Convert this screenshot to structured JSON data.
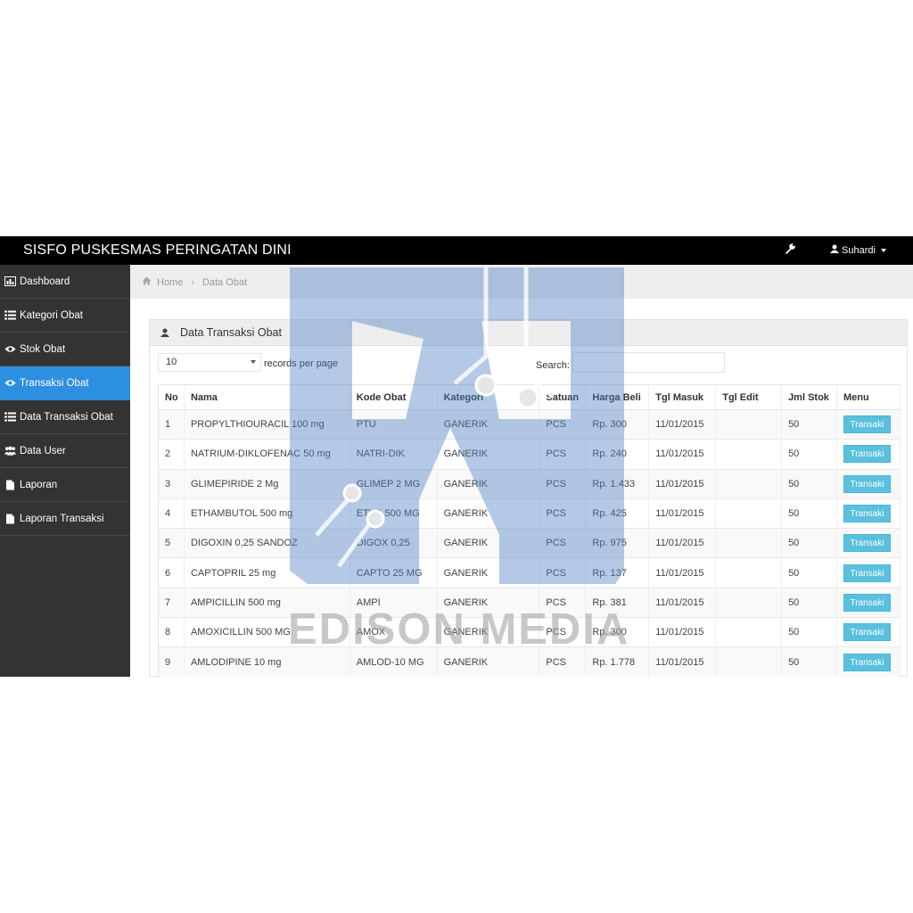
{
  "app": {
    "title": "SISFO PUSKESMAS PERINGATAN DINI"
  },
  "navbar": {
    "user": "Suhardi"
  },
  "sidebar": {
    "items": [
      {
        "label": "Dashboard",
        "icon": "bar-chart-icon"
      },
      {
        "label": "Kategori Obat",
        "icon": "list-icon"
      },
      {
        "label": "Stok Obat",
        "icon": "eye-icon"
      },
      {
        "label": "Transaksi Obat",
        "icon": "eye-icon",
        "active": true
      },
      {
        "label": "Data Transaksi Obat",
        "icon": "list-icon"
      },
      {
        "label": "Data User",
        "icon": "users-icon"
      },
      {
        "label": "Laporan",
        "icon": "file-icon"
      },
      {
        "label": "Laporan Transaksi",
        "icon": "file-icon"
      }
    ]
  },
  "breadcrumb": {
    "home": "Home",
    "current": "Data Obat"
  },
  "panel": {
    "title": "Data Transaksi Obat"
  },
  "table_controls": {
    "records_value": "10",
    "records_label": "records per page",
    "search_label": "Search:"
  },
  "table": {
    "headers": [
      "No",
      "Nama",
      "Kode Obat",
      "Kategori",
      "Satuan",
      "Harga Beli",
      "Tgl Masuk",
      "Tgl Edit",
      "Jml Stok",
      "Menu"
    ],
    "rows": [
      {
        "no": "1",
        "nama": "PROPYLTHIOURACIL 100 mg",
        "kode": "PTU",
        "kategori": "GANERIK",
        "satuan": "PCS",
        "harga": "Rp. 300",
        "tgl_masuk": "11/01/2015",
        "tgl_edit": "",
        "stok": "50",
        "menu": "Transaki"
      },
      {
        "no": "2",
        "nama": "NATRIUM-DIKLOFENAC 50 mg",
        "kode": "NATRI-DIK",
        "kategori": "GANERIK",
        "satuan": "PCS",
        "harga": "Rp. 240",
        "tgl_masuk": "11/01/2015",
        "tgl_edit": "",
        "stok": "50",
        "menu": "Transaki"
      },
      {
        "no": "3",
        "nama": "GLIMEPIRIDE 2 Mg",
        "kode": "GLIMEP 2 MG",
        "kategori": "GANERIK",
        "satuan": "PCS",
        "harga": "Rp. 1.433",
        "tgl_masuk": "11/01/2015",
        "tgl_edit": "",
        "stok": "50",
        "menu": "Transaki"
      },
      {
        "no": "4",
        "nama": "ETHAMBUTOL 500 mg",
        "kode": "ETHA 500 MG",
        "kategori": "GANERIK",
        "satuan": "PCS",
        "harga": "Rp. 425",
        "tgl_masuk": "11/01/2015",
        "tgl_edit": "",
        "stok": "50",
        "menu": "Transaki"
      },
      {
        "no": "5",
        "nama": "DIGOXIN 0,25 SANDOZ",
        "kode": "DIGOX 0,25",
        "kategori": "GANERIK",
        "satuan": "PCS",
        "harga": "Rp. 975",
        "tgl_masuk": "11/01/2015",
        "tgl_edit": "",
        "stok": "50",
        "menu": "Transaki"
      },
      {
        "no": "6",
        "nama": "CAPTOPRIL 25 mg",
        "kode": "CAPTO 25 MG",
        "kategori": "GANERIK",
        "satuan": "PCS",
        "harga": "Rp. 137",
        "tgl_masuk": "11/01/2015",
        "tgl_edit": "",
        "stok": "50",
        "menu": "Transaki"
      },
      {
        "no": "7",
        "nama": "AMPICILLIN 500 mg",
        "kode": "AMPI",
        "kategori": "GANERIK",
        "satuan": "PCS",
        "harga": "Rp. 381",
        "tgl_masuk": "11/01/2015",
        "tgl_edit": "",
        "stok": "50",
        "menu": "Transaki"
      },
      {
        "no": "8",
        "nama": "AMOXICILLIN 500 MG",
        "kode": "AMOX",
        "kategori": "GANERIK",
        "satuan": "PCS",
        "harga": "Rp. 300",
        "tgl_masuk": "11/01/2015",
        "tgl_edit": "",
        "stok": "50",
        "menu": "Transaki"
      },
      {
        "no": "9",
        "nama": "AMLODIPINE 10 mg",
        "kode": "AMLOD-10 MG",
        "kategori": "GANERIK",
        "satuan": "PCS",
        "harga": "Rp. 1.778",
        "tgl_masuk": "11/01/2015",
        "tgl_edit": "",
        "stok": "50",
        "menu": "Transaki"
      }
    ]
  },
  "watermark": {
    "text": "EDISON MEDIA"
  },
  "colors": {
    "navbar": "#000000",
    "sidebar": "#333333",
    "active": "#2d8fdf",
    "button": "#5bc0de",
    "watermark": "#4a7fc1"
  }
}
